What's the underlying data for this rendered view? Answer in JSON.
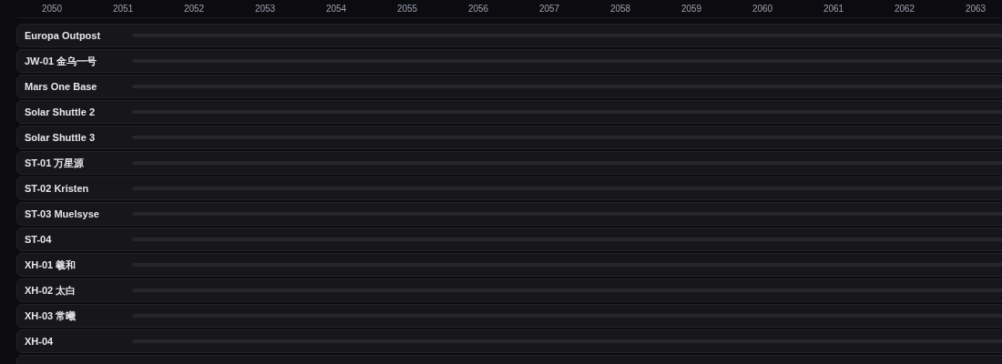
{
  "timeline": {
    "years": [
      "2050",
      "2051",
      "2052",
      "2053",
      "2054",
      "2055",
      "2056",
      "2057",
      "2058",
      "2059",
      "2060",
      "2061",
      "2062",
      "2063"
    ],
    "rows": [
      {
        "name": "Europa Outpost"
      },
      {
        "name": "JW-01 金乌一号"
      },
      {
        "name": "Mars One Base"
      },
      {
        "name": "Solar Shuttle 2"
      },
      {
        "name": "Solar Shuttle 3"
      },
      {
        "name": "ST-01 万星源"
      },
      {
        "name": "ST-02 Kristen"
      },
      {
        "name": "ST-03 Muelsyse"
      },
      {
        "name": "ST-04"
      },
      {
        "name": "XH-01 羲和"
      },
      {
        "name": "XH-02 太白"
      },
      {
        "name": "XH-03 常曦"
      },
      {
        "name": "XH-04"
      }
    ]
  }
}
